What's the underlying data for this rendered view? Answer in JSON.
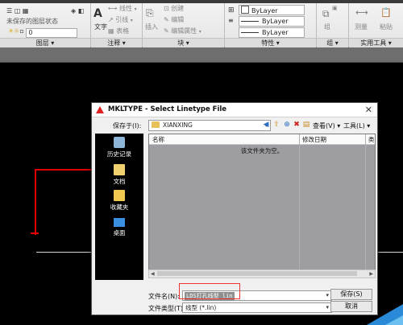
{
  "ribbon": {
    "layer_state": "未保存的图层状态",
    "layer_current": "0",
    "text_label": "文字",
    "insert_label": "插入",
    "dim_label": "线性",
    "leader_label": "引线",
    "table_label": "表格",
    "create_label": "创建",
    "edit_label": "编辑",
    "edit_attr_label": "编辑属性",
    "bylayer_1": "ByLayer",
    "bylayer_2": "ByLayer",
    "bylayer_3": "ByLayer",
    "group_label": "组",
    "measure_label": "测量",
    "paste_label": "粘贴",
    "groups": [
      "图层 ▾",
      "注释 ▾",
      "块 ▾",
      "特性 ▾",
      "组 ▾",
      "实用工具 ▾"
    ]
  },
  "dialog": {
    "title": "MKLTYPE - Select Linetype File",
    "look_in_label": "保存于(I):",
    "look_in_value": "XIANXING",
    "views_label": "查看(V)",
    "tools_label": "工具(L)",
    "places": [
      "历史记录",
      "文档",
      "收藏夹",
      "桌面"
    ],
    "columns": [
      "名称",
      "修改日期",
      "类"
    ],
    "empty_message": "该文件夹为空。",
    "filename_label": "文件名(N):",
    "filename_value": "LDS打孔线型 lin",
    "filetype_label": "文件类型(T):",
    "filetype_value": "线型 (*.lin)",
    "save_button": "保存(S)",
    "cancel_button": "取消"
  },
  "colors": {
    "canvas": "#000000",
    "ribbon": "#ededed",
    "accent_red": "#e00000",
    "corner_blue": "#2a8ad8"
  }
}
